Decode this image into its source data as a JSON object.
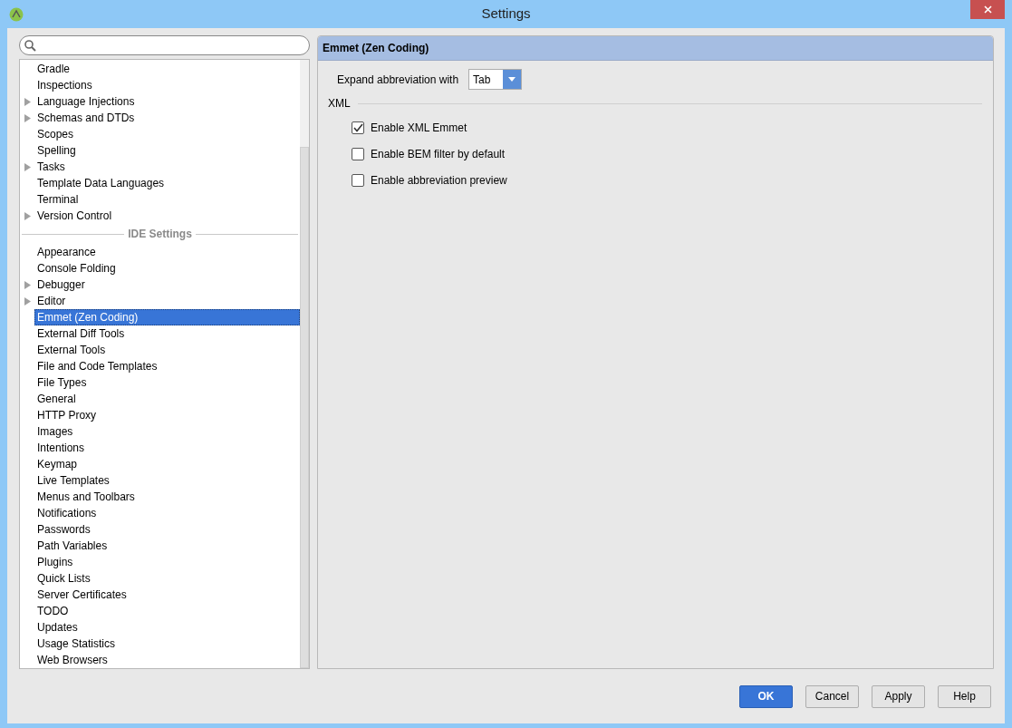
{
  "window": {
    "title": "Settings"
  },
  "tree": [
    {
      "kind": "item",
      "label": "Gradle",
      "expandable": false,
      "selected": false
    },
    {
      "kind": "item",
      "label": "Inspections",
      "expandable": false,
      "selected": false
    },
    {
      "kind": "item",
      "label": "Language Injections",
      "expandable": true,
      "selected": false
    },
    {
      "kind": "item",
      "label": "Schemas and DTDs",
      "expandable": true,
      "selected": false
    },
    {
      "kind": "item",
      "label": "Scopes",
      "expandable": false,
      "selected": false
    },
    {
      "kind": "item",
      "label": "Spelling",
      "expandable": false,
      "selected": false
    },
    {
      "kind": "item",
      "label": "Tasks",
      "expandable": true,
      "selected": false
    },
    {
      "kind": "item",
      "label": "Template Data Languages",
      "expandable": false,
      "selected": false
    },
    {
      "kind": "item",
      "label": "Terminal",
      "expandable": false,
      "selected": false
    },
    {
      "kind": "item",
      "label": "Version Control",
      "expandable": true,
      "selected": false
    },
    {
      "kind": "separator",
      "label": "IDE Settings"
    },
    {
      "kind": "item",
      "label": "Appearance",
      "expandable": false,
      "selected": false
    },
    {
      "kind": "item",
      "label": "Console Folding",
      "expandable": false,
      "selected": false
    },
    {
      "kind": "item",
      "label": "Debugger",
      "expandable": true,
      "selected": false
    },
    {
      "kind": "item",
      "label": "Editor",
      "expandable": true,
      "selected": false
    },
    {
      "kind": "item",
      "label": "Emmet (Zen Coding)",
      "expandable": false,
      "selected": true
    },
    {
      "kind": "item",
      "label": "External Diff Tools",
      "expandable": false,
      "selected": false
    },
    {
      "kind": "item",
      "label": "External Tools",
      "expandable": false,
      "selected": false
    },
    {
      "kind": "item",
      "label": "File and Code Templates",
      "expandable": false,
      "selected": false
    },
    {
      "kind": "item",
      "label": "File Types",
      "expandable": false,
      "selected": false
    },
    {
      "kind": "item",
      "label": "General",
      "expandable": false,
      "selected": false
    },
    {
      "kind": "item",
      "label": "HTTP Proxy",
      "expandable": false,
      "selected": false
    },
    {
      "kind": "item",
      "label": "Images",
      "expandable": false,
      "selected": false
    },
    {
      "kind": "item",
      "label": "Intentions",
      "expandable": false,
      "selected": false
    },
    {
      "kind": "item",
      "label": "Keymap",
      "expandable": false,
      "selected": false
    },
    {
      "kind": "item",
      "label": "Live Templates",
      "expandable": false,
      "selected": false
    },
    {
      "kind": "item",
      "label": "Menus and Toolbars",
      "expandable": false,
      "selected": false
    },
    {
      "kind": "item",
      "label": "Notifications",
      "expandable": false,
      "selected": false
    },
    {
      "kind": "item",
      "label": "Passwords",
      "expandable": false,
      "selected": false
    },
    {
      "kind": "item",
      "label": "Path Variables",
      "expandable": false,
      "selected": false
    },
    {
      "kind": "item",
      "label": "Plugins",
      "expandable": false,
      "selected": false
    },
    {
      "kind": "item",
      "label": "Quick Lists",
      "expandable": false,
      "selected": false
    },
    {
      "kind": "item",
      "label": "Server Certificates",
      "expandable": false,
      "selected": false
    },
    {
      "kind": "item",
      "label": "TODO",
      "expandable": false,
      "selected": false
    },
    {
      "kind": "item",
      "label": "Updates",
      "expandable": false,
      "selected": false
    },
    {
      "kind": "item",
      "label": "Usage Statistics",
      "expandable": false,
      "selected": false
    },
    {
      "kind": "item",
      "label": "Web Browsers",
      "expandable": false,
      "selected": false
    }
  ],
  "panel": {
    "title": "Emmet (Zen Coding)",
    "expand_label": "Expand abbreviation with",
    "expand_value": "Tab",
    "group_label": "XML",
    "options": [
      {
        "label": "Enable XML Emmet",
        "checked": true
      },
      {
        "label": "Enable BEM filter by default",
        "checked": false
      },
      {
        "label": "Enable abbreviation preview",
        "checked": false
      }
    ]
  },
  "buttons": [
    {
      "label": "OK",
      "default": true
    },
    {
      "label": "Cancel",
      "default": false
    },
    {
      "label": "Apply",
      "default": false
    },
    {
      "label": "Help",
      "default": false
    }
  ]
}
